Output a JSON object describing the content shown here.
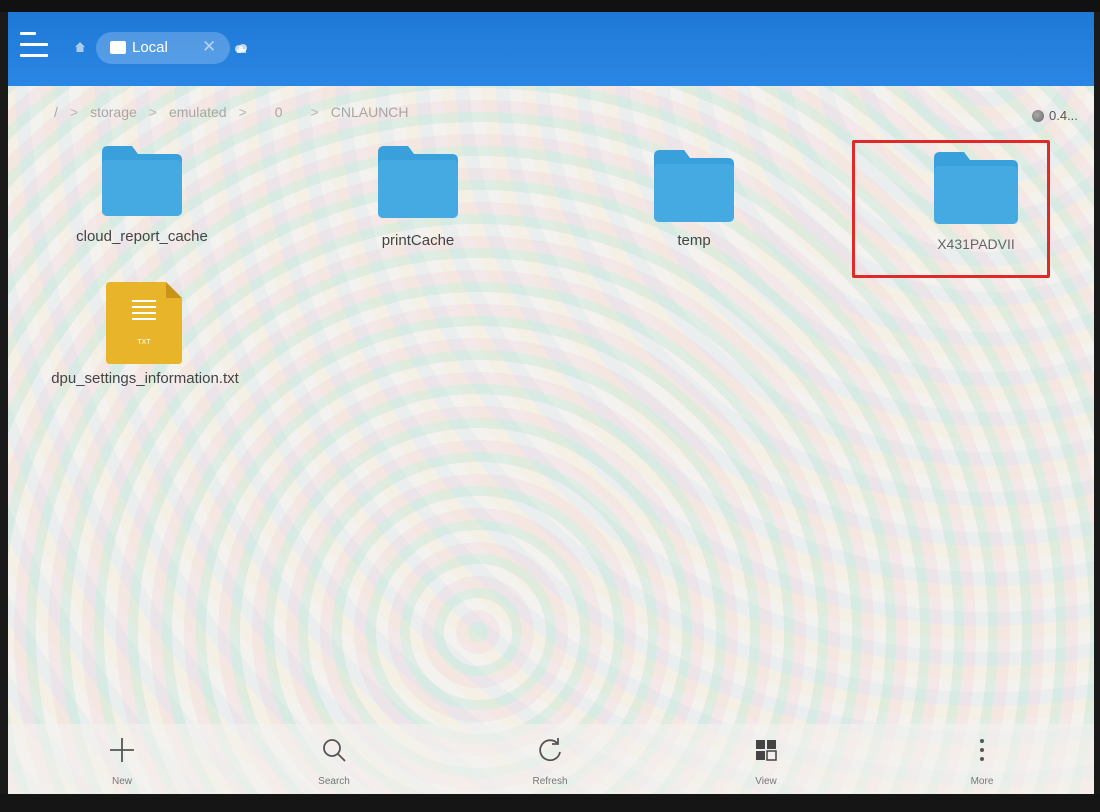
{
  "topbar": {
    "tab_label": "Local",
    "tab_close": "✕",
    "menu_icon": "hamburger-menu-icon",
    "home_icon": "home-icon",
    "cloud_icon": "cloud-icon",
    "color": "#2a86e4"
  },
  "breadcrumb": {
    "items": [
      "/",
      "storage",
      "emulated",
      "0",
      "CNLAUNCH"
    ],
    "separator": ">"
  },
  "storage": {
    "label": "0.4..."
  },
  "files": [
    {
      "name": "cloud_report_cache",
      "type": "folder"
    },
    {
      "name": "printCache",
      "type": "folder"
    },
    {
      "name": "temp",
      "type": "folder"
    },
    {
      "name": "X431PADVII",
      "type": "folder",
      "highlighted": true
    },
    {
      "name": "dpu_settings_information.txt",
      "type": "txt",
      "icon_text": "TXT"
    }
  ],
  "bottombar": {
    "actions": [
      {
        "label": "New",
        "icon": "plus-icon"
      },
      {
        "label": "Search",
        "icon": "search-icon"
      },
      {
        "label": "Refresh",
        "icon": "refresh-icon"
      },
      {
        "label": "View",
        "icon": "view-grid-icon"
      },
      {
        "label": "More",
        "icon": "more-vertical-icon"
      }
    ]
  },
  "colors": {
    "folder": "#3aa0dc",
    "highlight": "#e02a2a",
    "txt_icon": "#e8b52a"
  }
}
